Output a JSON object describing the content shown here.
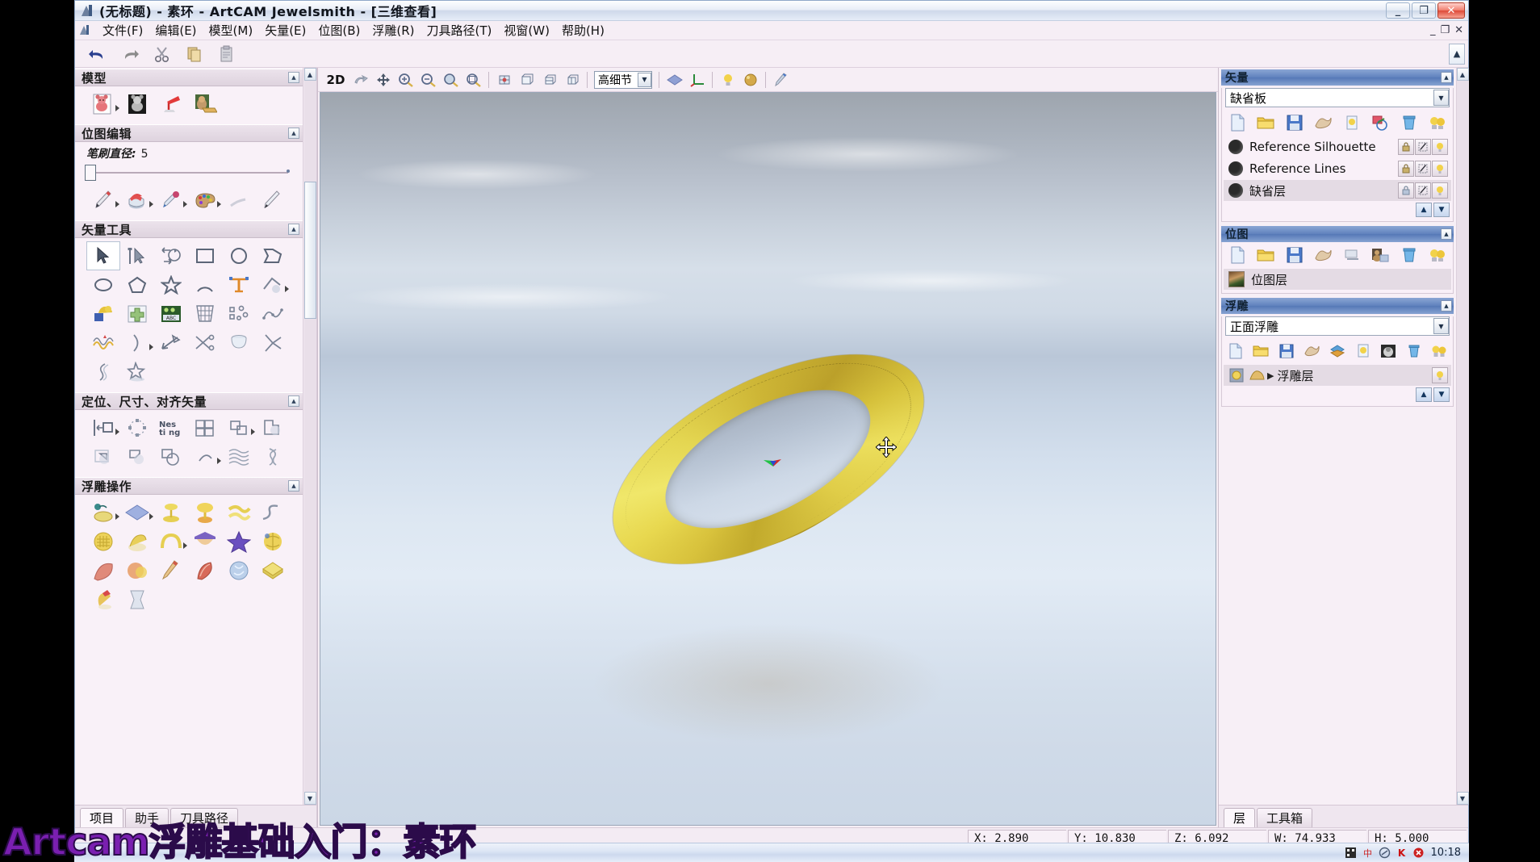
{
  "window": {
    "title": "(无标题) - 素环 - ArtCAM Jewelsmith - [三维查看]",
    "minimize": "_",
    "restore": "❐",
    "close": "✕",
    "inner_minimize": "_",
    "inner_restore": "❐",
    "inner_close": "✕"
  },
  "menubar": {
    "items": [
      {
        "label": "文件(F)"
      },
      {
        "label": "编辑(E)"
      },
      {
        "label": "模型(M)"
      },
      {
        "label": "矢量(E)"
      },
      {
        "label": "位图(B)"
      },
      {
        "label": "浮雕(R)"
      },
      {
        "label": "刀具路径(T)"
      },
      {
        "label": "视窗(W)"
      },
      {
        "label": "帮助(H)"
      }
    ]
  },
  "toolbar": {
    "buttons": [
      {
        "name": "undo",
        "icon": "undo-icon"
      },
      {
        "name": "redo",
        "icon": "redo-icon"
      },
      {
        "name": "cut",
        "icon": "scissors-icon"
      },
      {
        "name": "copy",
        "icon": "copy-icon"
      },
      {
        "name": "paste",
        "icon": "paste-icon"
      }
    ],
    "collapse": "▲"
  },
  "left_panel": {
    "sections": [
      {
        "title": "模型",
        "expander": "▲",
        "tools": [
          {
            "label": "新建模型",
            "icon": "new-model-icon",
            "has_arrow": true
          },
          {
            "label": "打开模型",
            "icon": "open-model-icon",
            "has_arrow": false
          },
          {
            "label": "灯光设置",
            "icon": "lamp-icon",
            "has_arrow": false
          },
          {
            "label": "材质设置",
            "icon": "material-icon",
            "has_arrow": false
          }
        ]
      },
      {
        "title": "位图编辑",
        "expander": "▲",
        "brush_label": "笔刷直径:",
        "brush_value": "5",
        "tools": [
          {
            "label": "画笔",
            "icon": "pencil-icon",
            "has_arrow": true
          },
          {
            "label": "填充",
            "icon": "paint-bucket-icon",
            "has_arrow": true
          },
          {
            "label": "取色器",
            "icon": "eyedropper-icon",
            "has_arrow": true
          },
          {
            "label": "调色板",
            "icon": "palette-icon",
            "has_arrow": true
          },
          {
            "label": "橡皮",
            "icon": "eraser-icon",
            "has_arrow": false
          },
          {
            "label": "直线",
            "icon": "line-icon",
            "has_arrow": false
          }
        ]
      },
      {
        "title": "矢量工具",
        "expander": "▲",
        "tools": [
          {
            "label": "选择矢量",
            "icon": "arrow-select-icon",
            "selected": true
          },
          {
            "label": "节点编辑",
            "icon": "node-edit-icon"
          },
          {
            "label": "变换矢量",
            "icon": "transform-icon"
          },
          {
            "label": "矩形",
            "icon": "rectangle-icon"
          },
          {
            "label": "圆形",
            "icon": "circle-icon"
          },
          {
            "label": "折线",
            "icon": "polyline-icon"
          },
          {
            "label": "椭圆",
            "icon": "ellipse-icon"
          },
          {
            "label": "多边形",
            "icon": "polygon-icon"
          },
          {
            "label": "星形",
            "icon": "star-icon"
          },
          {
            "label": "圆弧",
            "icon": "arc-icon"
          },
          {
            "label": "文字",
            "icon": "text-tool-icon"
          },
          {
            "label": "矢量编辑",
            "icon": "vector-edit-icon",
            "has_arrow": true
          },
          {
            "label": "位图到矢量",
            "icon": "bitmap-to-vector-icon"
          },
          {
            "label": "创建矢量边界",
            "icon": "vector-boundary-icon"
          },
          {
            "label": "矢量分割",
            "icon": "vector-split-icon"
          },
          {
            "label": "矢量网格",
            "icon": "vector-grid-icon"
          },
          {
            "label": "节点分布",
            "icon": "node-distribute-icon"
          },
          {
            "label": "光滑矢量",
            "icon": "smooth-vector-icon"
          },
          {
            "label": "矢量波纹",
            "icon": "vector-wave-icon"
          },
          {
            "label": "弧线适配",
            "icon": "arc-fit-icon",
            "has_arrow": true
          },
          {
            "label": "测量",
            "icon": "measure-icon"
          },
          {
            "label": "矢量修剪",
            "icon": "vector-trim-icon"
          },
          {
            "label": "封套",
            "icon": "envelope-icon"
          },
          {
            "label": "斜接",
            "icon": "miter-icon"
          },
          {
            "label": "轮廓线",
            "icon": "contour-icon"
          },
          {
            "label": "星形装饰",
            "icon": "star-decor-icon"
          }
        ]
      },
      {
        "title": "定位、尺寸、对齐矢量",
        "expander": "▲",
        "tools": [
          {
            "label": "对齐到材料",
            "icon": "align-material-icon",
            "has_arrow": true
          },
          {
            "label": "旋转复制",
            "icon": "rotate-copy-icon"
          },
          {
            "label": "Nesting 排料",
            "icon": "nesting-icon"
          },
          {
            "label": "块复制",
            "icon": "block-copy-icon"
          },
          {
            "label": "对齐矢量",
            "icon": "align-vectors-icon",
            "has_arrow": true
          },
          {
            "label": "焊接",
            "icon": "weld-icon"
          },
          {
            "label": "相减",
            "icon": "subtract-icon"
          },
          {
            "label": "相交",
            "icon": "intersect-icon"
          },
          {
            "label": "分离",
            "icon": "separate-icon"
          },
          {
            "label": "适配弧线",
            "icon": "fit-arc-icon",
            "has_arrow": true
          },
          {
            "label": "波纹织物",
            "icon": "weave-icon"
          },
          {
            "label": "扭曲",
            "icon": "twist-icon"
          }
        ]
      },
      {
        "title": "浮雕操作",
        "expander": "▲",
        "tools": [
          {
            "label": "形状编辑器",
            "icon": "shape-editor-icon",
            "has_arrow": true
          },
          {
            "label": "平面浮雕",
            "icon": "plane-relief-icon",
            "has_arrow": true
          },
          {
            "label": "旋转浮雕",
            "icon": "spin-relief-icon"
          },
          {
            "label": "拉伸浮雕",
            "icon": "extrude-relief-icon"
          },
          {
            "label": "编织浮雕",
            "icon": "weave-relief-icon"
          },
          {
            "label": "S形浮雕",
            "icon": "s-relief-icon"
          },
          {
            "label": "纹理浮雕",
            "icon": "texture-relief-icon"
          },
          {
            "label": "雕刻浮雕",
            "icon": "carve-relief-icon"
          },
          {
            "label": "环形浮雕",
            "icon": "ring-relief-icon",
            "has_arrow": true
          },
          {
            "label": "圆顶浮雕",
            "icon": "dome-relief-icon"
          },
          {
            "label": "星形浮雕",
            "icon": "star-relief-icon"
          },
          {
            "label": "球形浮雕",
            "icon": "sphere-relief-icon"
          },
          {
            "label": "羽化浮雕",
            "icon": "feather-relief-icon"
          },
          {
            "label": "融合浮雕",
            "icon": "blend-relief-icon"
          },
          {
            "label": "笔刷浮雕",
            "icon": "brush-relief-icon"
          },
          {
            "label": "雕花浮雕",
            "icon": "flower-relief-icon"
          },
          {
            "label": "晶体浮雕",
            "icon": "crystal-relief-icon"
          },
          {
            "label": "黄金浮雕",
            "icon": "gold-relief-icon"
          },
          {
            "label": "宝石浮雕",
            "icon": "gem-relief-icon"
          },
          {
            "label": "柱体浮雕",
            "icon": "column-relief-icon"
          }
        ]
      }
    ],
    "tabs": [
      {
        "label": "项目",
        "active": true
      },
      {
        "label": "助手",
        "active": false
      },
      {
        "label": "刀具路径",
        "active": false
      }
    ]
  },
  "view_toolbar": {
    "mode_2d": "2D",
    "detail_level": "高细节",
    "dropdown_arrow": "▼",
    "buttons": [
      {
        "name": "rotate-view",
        "icon": "rotate-view-icon"
      },
      {
        "name": "pan-view",
        "icon": "pan-icon"
      },
      {
        "name": "zoom-in",
        "icon": "zoom-in-icon"
      },
      {
        "name": "zoom-out",
        "icon": "zoom-out-icon"
      },
      {
        "name": "zoom-window",
        "icon": "zoom-window-icon"
      },
      {
        "name": "zoom-fit",
        "icon": "zoom-fit-icon"
      },
      {
        "name": "iso-view",
        "icon": "iso-view-icon"
      },
      {
        "name": "front-view",
        "icon": "front-view-icon"
      },
      {
        "name": "side-view",
        "icon": "side-view-icon"
      },
      {
        "name": "top-view",
        "icon": "top-view-icon"
      },
      {
        "name": "shading",
        "icon": "shading-icon"
      },
      {
        "name": "axis-toggle",
        "icon": "axis-icon"
      },
      {
        "name": "light-toggle",
        "icon": "lightbulb-icon"
      },
      {
        "name": "material-toggle",
        "icon": "material-ball-icon"
      },
      {
        "name": "paint-toggle",
        "icon": "paint-icon"
      }
    ]
  },
  "viewport": {
    "model_name": "素环",
    "model_color": "#e5d24d",
    "background_top": "#9ea5ae",
    "background_bottom": "#cbd7e6",
    "cursor": "move-cursor",
    "gizmo": "axis-gizmo"
  },
  "right_panel": {
    "vector_section": {
      "title": "矢量",
      "expander": "▲",
      "selected_sheet": "缺省板",
      "dropdown_arrow": "▼",
      "toolbar": [
        {
          "name": "new-vector-layer",
          "icon": "new-file-icon"
        },
        {
          "name": "open-vector-layer",
          "icon": "folder-icon"
        },
        {
          "name": "save-vector-layer",
          "icon": "save-icon"
        },
        {
          "name": "merge-vector-layer",
          "icon": "merge-icon"
        },
        {
          "name": "vector-visibility",
          "icon": "bulb-small-icon"
        },
        {
          "name": "vector-duplicate",
          "icon": "duplicate-icon"
        },
        {
          "name": "delete-vector-layer",
          "icon": "trash-icon"
        },
        {
          "name": "show-all-layers",
          "icon": "bulbs-icon"
        }
      ],
      "layers": [
        {
          "name": "Reference Silhouette",
          "selected": false,
          "lock": "🔒",
          "edit": "✎",
          "visible": "💡"
        },
        {
          "name": "Reference Lines",
          "selected": false,
          "lock": "🔒",
          "edit": "✎",
          "visible": "💡"
        },
        {
          "name": "缺省层",
          "selected": true,
          "lock": "🔒",
          "edit": "✎",
          "visible": "💡"
        }
      ],
      "order_up": "▲",
      "order_down": "▼"
    },
    "bitmap_section": {
      "title": "位图",
      "expander": "▲",
      "toolbar": [
        {
          "name": "new-bitmap-layer",
          "icon": "new-file-icon"
        },
        {
          "name": "open-bitmap-layer",
          "icon": "folder-icon"
        },
        {
          "name": "save-bitmap-layer",
          "icon": "save-icon"
        },
        {
          "name": "merge-bitmap-layer",
          "icon": "merge-icon"
        },
        {
          "name": "flatten-bitmap",
          "icon": "flatten-icon"
        },
        {
          "name": "bitmap-properties",
          "icon": "portrait-icon"
        },
        {
          "name": "delete-bitmap-layer",
          "icon": "trash-icon"
        },
        {
          "name": "show-all-bitmaps",
          "icon": "bulbs-icon"
        }
      ],
      "layers": [
        {
          "name": "位图层",
          "selected": true
        }
      ]
    },
    "relief_section": {
      "title": "浮雕",
      "expander": "▲",
      "selected_relief": "正面浮雕",
      "dropdown_arrow": "▼",
      "toolbar": [
        {
          "name": "new-relief-layer",
          "icon": "new-file-icon"
        },
        {
          "name": "open-relief-layer",
          "icon": "folder-icon"
        },
        {
          "name": "save-relief-layer",
          "icon": "save-icon"
        },
        {
          "name": "merge-relief-layer",
          "icon": "merge-icon"
        },
        {
          "name": "relief-stack",
          "icon": "stack-icon"
        },
        {
          "name": "relief-visibility",
          "icon": "bulb-small-icon"
        },
        {
          "name": "relief-greyscale",
          "icon": "greyscale-icon"
        },
        {
          "name": "delete-relief-layer",
          "icon": "trash-icon"
        },
        {
          "name": "show-all-reliefs",
          "icon": "bulbs-icon"
        }
      ],
      "layers": [
        {
          "name": "浮雕层",
          "selected": true,
          "expand_arrow": "▶",
          "visible": "💡"
        }
      ],
      "order_up": "▲",
      "order_down": "▼"
    },
    "tabs": [
      {
        "label": "层",
        "active": true
      },
      {
        "label": "工具箱",
        "active": false
      }
    ]
  },
  "statusbar": {
    "fields": [
      {
        "label": "X: 2.890"
      },
      {
        "label": "Y: 10.830"
      },
      {
        "label": "Z: 6.092"
      },
      {
        "label": "W: 74.933"
      },
      {
        "label": "H: 5.000"
      }
    ]
  },
  "taskbar": {
    "clock": "10:18",
    "tray": [
      {
        "name": "ime-icon"
      },
      {
        "name": "pinyin-icon"
      },
      {
        "name": "network-icon"
      },
      {
        "name": "kingsoft-icon"
      },
      {
        "name": "antivirus-icon"
      }
    ]
  },
  "overlay": {
    "caption": "Artcam浮雕基础入门：素环"
  }
}
